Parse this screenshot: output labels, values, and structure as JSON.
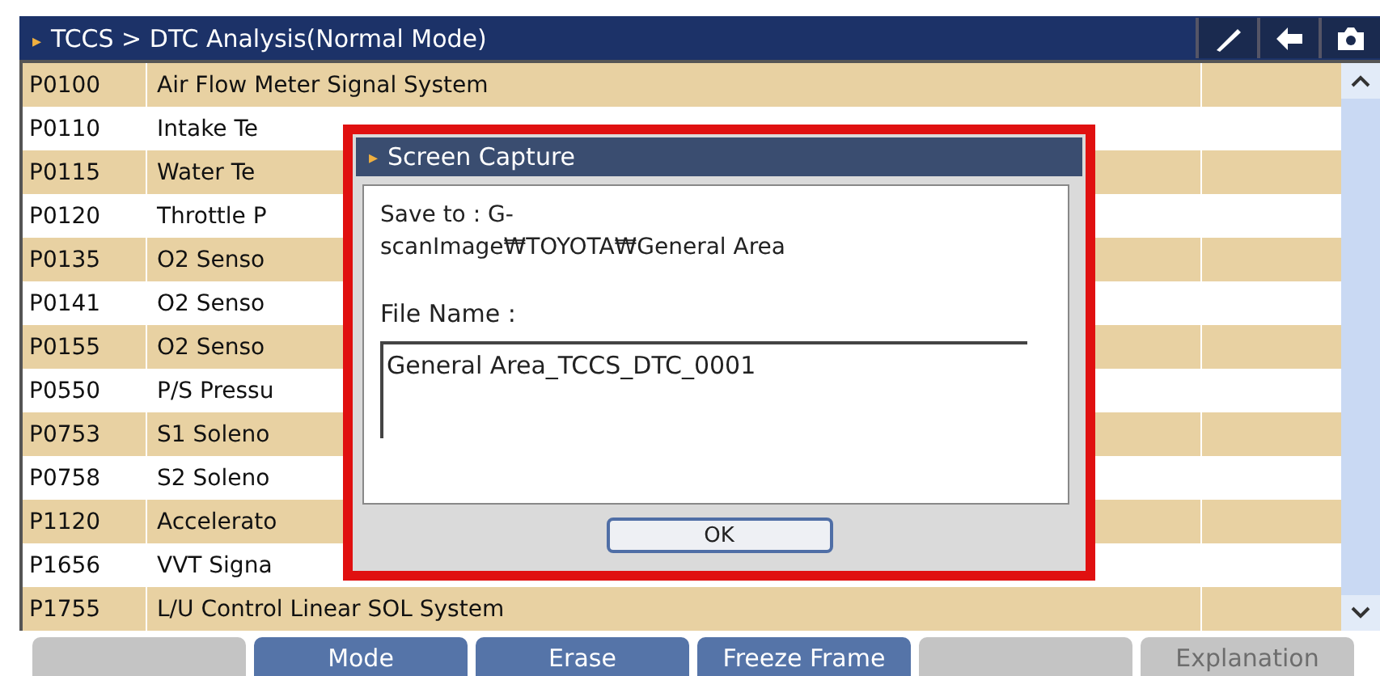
{
  "header": {
    "marker": "▸",
    "title": "TCCS > DTC Analysis(Normal Mode)"
  },
  "rows": [
    {
      "code": "P0100",
      "description": "Air Flow Meter Signal System"
    },
    {
      "code": "P0110",
      "description": "Intake Te"
    },
    {
      "code": "P0115",
      "description": "Water Te"
    },
    {
      "code": "P0120",
      "description": "Throttle P"
    },
    {
      "code": "P0135",
      "description": "O2 Senso"
    },
    {
      "code": "P0141",
      "description": "O2 Senso"
    },
    {
      "code": "P0155",
      "description": "O2 Senso"
    },
    {
      "code": "P0550",
      "description": "P/S Pressu"
    },
    {
      "code": "P0753",
      "description": "S1 Soleno"
    },
    {
      "code": "P0758",
      "description": "S2 Soleno"
    },
    {
      "code": "P1120",
      "description": "Accelerato"
    },
    {
      "code": "P1656",
      "description": "VVT Signa"
    },
    {
      "code": "P1755",
      "description": "L/U Control Linear SOL System"
    }
  ],
  "buttons": [
    {
      "disabled": true
    },
    {
      "label": "Mode",
      "disabled": false
    },
    {
      "label": "Erase",
      "disabled": false
    },
    {
      "label": "Freeze Frame",
      "disabled": false
    },
    {
      "disabled": true
    },
    {
      "label": "Explanation",
      "disabled": true
    }
  ],
  "dialog": {
    "marker": "▸",
    "title": "Screen Capture",
    "save_to": "Save to : G-scanImage₩TOYOTA₩General Area",
    "file_name_label": "File Name :",
    "file_name": "General Area_TCCS_DTC_0001",
    "ok": "OK"
  }
}
